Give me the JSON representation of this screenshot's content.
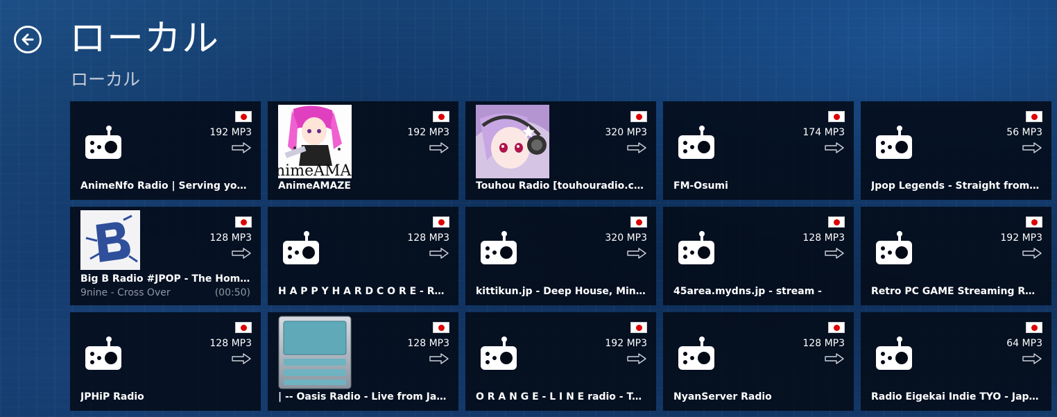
{
  "header": {
    "title": "ローカル",
    "subtitle": "ローカル"
  },
  "colors": {
    "tile_bg": "#040a16",
    "flag_red": "#dd0000",
    "muted_text": "#8f98a5"
  },
  "stations": [
    {
      "name": "AnimeNfo Radio | Serving you the best Anime music!",
      "bitrate": "192 MP3",
      "art": "radio-icon",
      "country": "JP"
    },
    {
      "name": "AnimeAMAZE",
      "bitrate": "192 MP3",
      "art": "anime-amaze-artwork",
      "art_text": "nimeAMAZ",
      "country": "JP"
    },
    {
      "name": "Touhou Radio [touhouradio.com]",
      "bitrate": "320 MP3",
      "art": "touhou-artwork",
      "country": "JP"
    },
    {
      "name": "FM-Osumi",
      "bitrate": "174 MP3",
      "art": "radio-icon",
      "country": "JP"
    },
    {
      "name": "Jpop Legends - Straight from Japan",
      "bitrate": "56 MP3",
      "art": "radio-icon",
      "country": "JP"
    },
    {
      "name": "Big B Radio #JPOP - The Home of Asian Pop",
      "bitrate": "128 MP3",
      "art": "big-b-artwork",
      "country": "JP",
      "now_playing": {
        "track": "9nine - Cross Over",
        "time": "(00:50)"
      }
    },
    {
      "name": "H A P P Y H A R D C O R E - Radio",
      "bitrate": "128 MP3",
      "art": "radio-icon",
      "country": "JP"
    },
    {
      "name": "kittikun.jp - Deep House, Minimal",
      "bitrate": "320 MP3",
      "art": "radio-icon",
      "country": "JP"
    },
    {
      "name": "45area.mydns.jp - stream -",
      "bitrate": "128 MP3",
      "art": "radio-icon",
      "country": "JP"
    },
    {
      "name": "Retro PC GAME Streaming Radio",
      "bitrate": "192 MP3",
      "art": "radio-icon",
      "country": "JP"
    },
    {
      "name": "JPHiP Radio",
      "bitrate": "128 MP3",
      "art": "radio-icon",
      "country": "JP"
    },
    {
      "name": "| -- Oasis Radio - Live from Japan",
      "bitrate": "128 MP3",
      "art": "oasis-artwork",
      "country": "JP"
    },
    {
      "name": "O R A N G E - L I N E radio - Tokyo",
      "bitrate": "192 MP3",
      "art": "radio-icon",
      "country": "JP"
    },
    {
      "name": "NyanServer Radio",
      "bitrate": "128 MP3",
      "art": "radio-icon",
      "country": "JP"
    },
    {
      "name": "Radio Eigekai Indie TYO - Japan",
      "bitrate": "64 MP3",
      "art": "radio-icon",
      "country": "JP"
    }
  ]
}
